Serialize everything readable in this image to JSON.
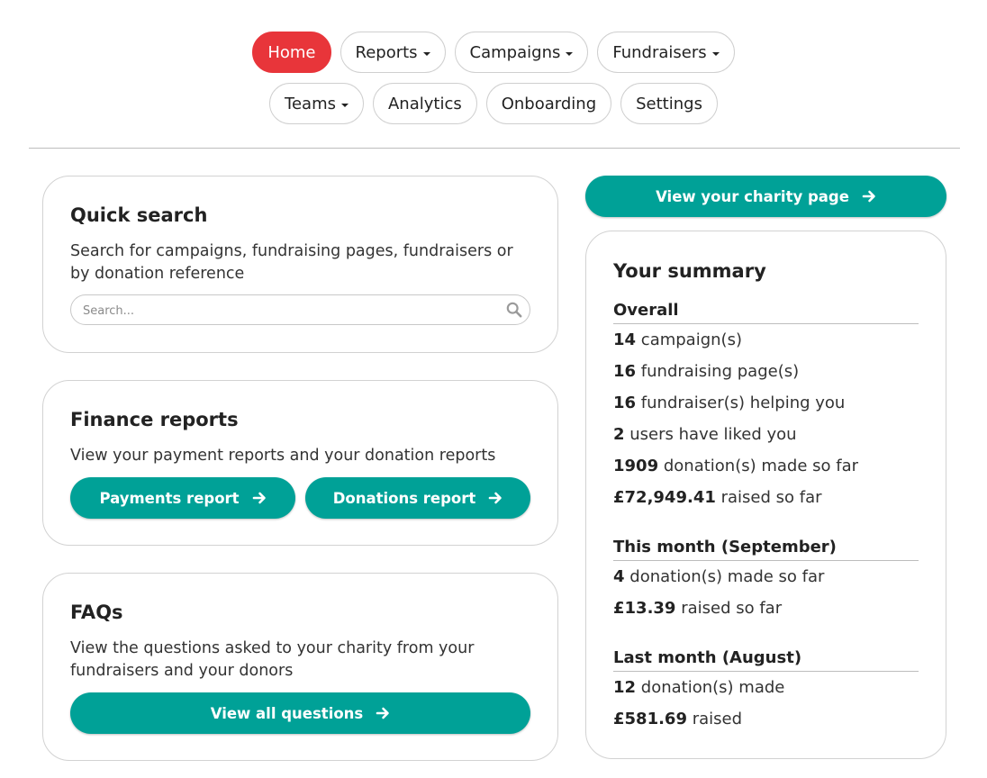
{
  "nav": {
    "row1": [
      {
        "label": "Home",
        "dropdown": false,
        "active": true
      },
      {
        "label": "Reports",
        "dropdown": true
      },
      {
        "label": "Campaigns",
        "dropdown": true
      },
      {
        "label": "Fundraisers",
        "dropdown": true
      }
    ],
    "row2": [
      {
        "label": "Teams",
        "dropdown": true
      },
      {
        "label": "Analytics",
        "dropdown": false
      },
      {
        "label": "Onboarding",
        "dropdown": false
      },
      {
        "label": "Settings",
        "dropdown": false
      }
    ]
  },
  "quick_search": {
    "title": "Quick search",
    "description": "Search for campaigns, fundraising pages, fundraisers or by donation reference",
    "placeholder": "Search..."
  },
  "finance": {
    "title": "Finance reports",
    "description": "View your payment reports and your donation reports",
    "payments_button": "Payments report",
    "donations_button": "Donations report"
  },
  "faqs": {
    "title": "FAQs",
    "description": "View the questions asked to your charity from your fundraisers and your donors",
    "button": "View all questions"
  },
  "charity_page_button": "View your charity page",
  "summary": {
    "title": "Your summary",
    "overall": {
      "title": "Overall",
      "campaigns": {
        "value": "14",
        "text": "campaign(s)"
      },
      "pages": {
        "value": "16",
        "text": "fundraising page(s)"
      },
      "fundraisers": {
        "value": "16",
        "text": "fundraiser(s) helping you"
      },
      "likes": {
        "value": "2",
        "text": "users have liked you"
      },
      "donations": {
        "value": "1909",
        "text": "donation(s) made so far"
      },
      "raised": {
        "value": "£72,949.41",
        "text": "raised so far"
      }
    },
    "this_month": {
      "title": "This month (September)",
      "donations": {
        "value": "4",
        "text": "donation(s) made so far"
      },
      "raised": {
        "value": "£13.39",
        "text": "raised so far"
      }
    },
    "last_month": {
      "title": "Last month (August)",
      "donations": {
        "value": "12",
        "text": "donation(s) made"
      },
      "raised": {
        "value": "£581.69",
        "text": "raised"
      }
    }
  },
  "colors": {
    "active_nav": "#e8353a",
    "teal_button": "#00a197"
  }
}
